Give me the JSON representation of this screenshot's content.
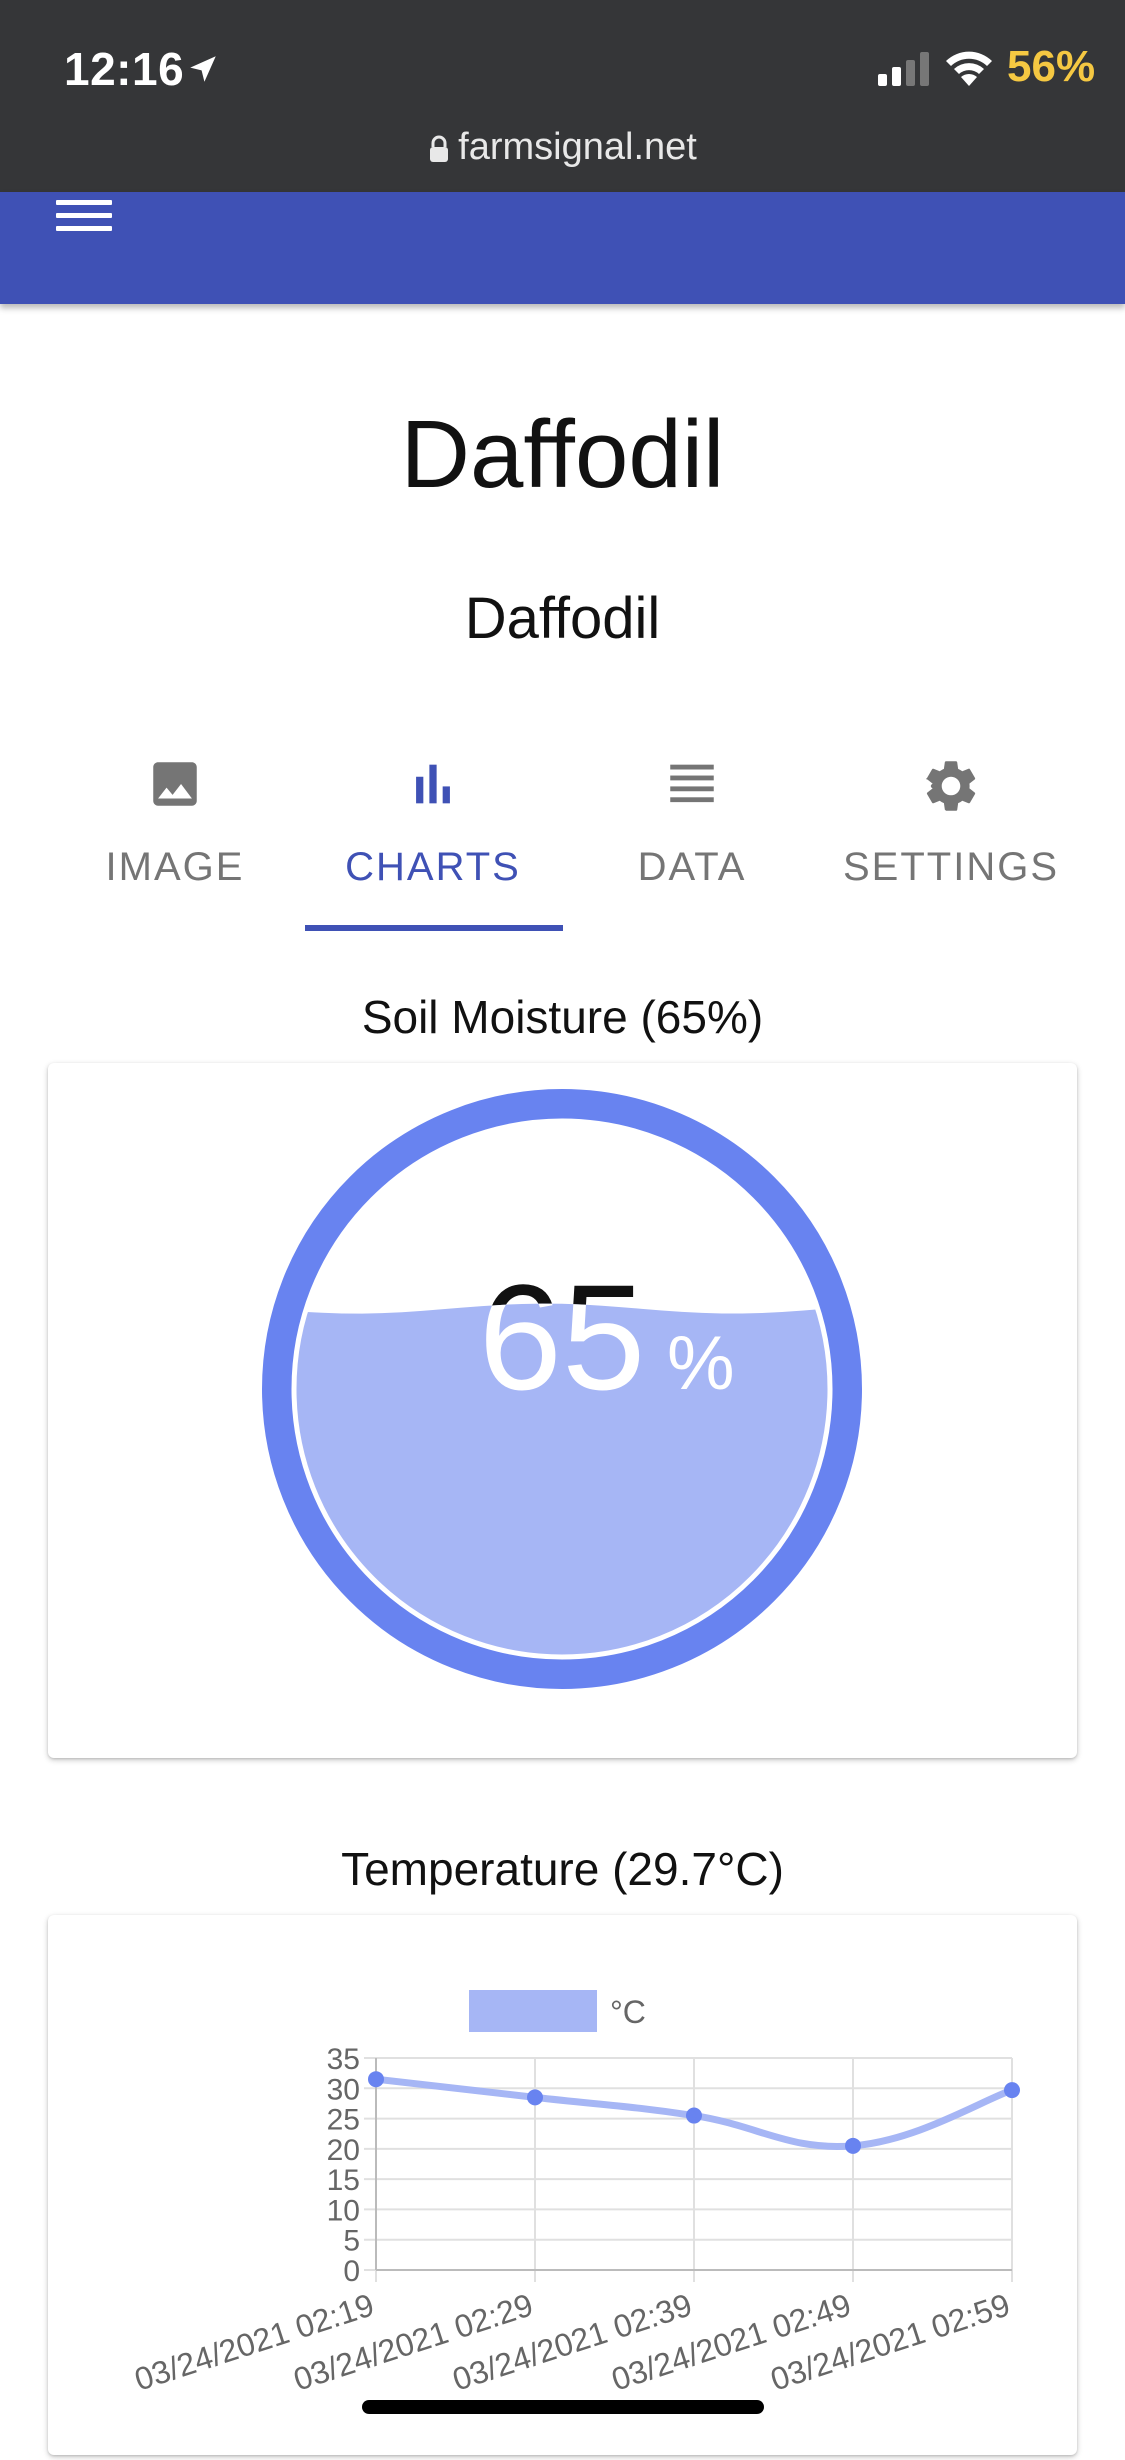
{
  "status_bar": {
    "time": "12:16",
    "battery": "56%",
    "url": "farmsignal.net"
  },
  "page": {
    "title": "Daffodil",
    "subtitle": "Daffodil"
  },
  "tabs": [
    {
      "label": "IMAGE",
      "icon": "image-icon",
      "active": false
    },
    {
      "label": "CHARTS",
      "icon": "bar-chart-icon",
      "active": true
    },
    {
      "label": "DATA",
      "icon": "list-icon",
      "active": false
    },
    {
      "label": "SETTINGS",
      "icon": "gear-icon",
      "active": false
    }
  ],
  "colors": {
    "appbar": "#3f51b5",
    "gauge_ring": "#6883f0",
    "gauge_fill": "#a6b6f5",
    "line": "#a6b6f5",
    "point": "#6883f0"
  },
  "moisture": {
    "heading": "Soil Moisture (65%)",
    "value": 65,
    "value_text": "65",
    "unit": "%"
  },
  "temperature": {
    "heading": "Temperature (29.7°C)"
  },
  "chart_data": {
    "type": "line",
    "title": "",
    "legend": "top-center",
    "series": [
      {
        "name": "°C",
        "values": [
          31.5,
          28.5,
          25.5,
          20.5,
          29.7
        ]
      }
    ],
    "categories": [
      "03/24/2021 02:19",
      "03/24/2021 02:29",
      "03/24/2021 02:39",
      "03/24/2021 02:49",
      "03/24/2021 02:59"
    ],
    "yticks": [
      "35",
      "30",
      "25",
      "20",
      "15",
      "10",
      "5",
      "0"
    ],
    "ylim": [
      0,
      35
    ],
    "grid": true
  }
}
